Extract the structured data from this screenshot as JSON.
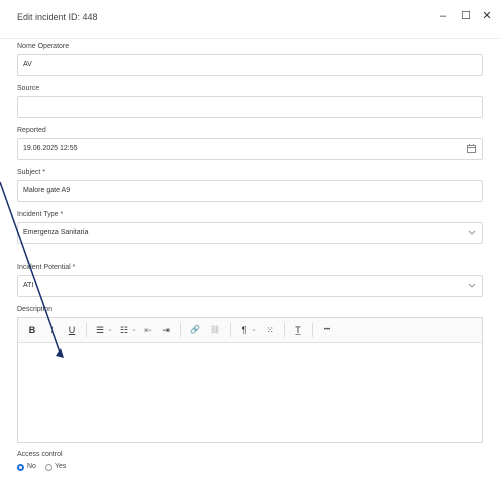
{
  "dialog": {
    "title": "Edit incident ID: 448",
    "minimize_glyph": "–",
    "maximize_glyph": "☐",
    "close_glyph": "✕"
  },
  "form": {
    "nome_operatore": {
      "label": "Nome Operatore",
      "value": "AV"
    },
    "source": {
      "label": "Source",
      "value": ""
    },
    "reported": {
      "label": "Reported",
      "value": "19.06.2025 12:55",
      "icon": "calendar-icon"
    },
    "subject": {
      "label": "Subject *",
      "value": "Malore gate A9"
    },
    "incident_type": {
      "label": "Incident Type *",
      "value": "Emergenza Sanitaria",
      "icon": "chevron-down-icon"
    },
    "incident_potential": {
      "label": "Incident Potential *",
      "value": "ATI",
      "icon": "chevron-down-icon"
    },
    "description": {
      "label": "Description",
      "value": "",
      "toolbar": {
        "bold": "B",
        "italic": "I",
        "underline": "U",
        "bullet_list": "☰",
        "numbered_list": "☷",
        "outdent": "⇤",
        "indent": "⇥",
        "link": "🔗",
        "unlink": "⛓",
        "format": "¶",
        "align": "⁙",
        "clear_format": "T̲",
        "more": "•••",
        "dropdown": "⌄"
      }
    },
    "access_control": {
      "label": "Access control",
      "options": [
        {
          "label": "No",
          "selected": true
        },
        {
          "label": "Yes",
          "selected": false
        }
      ]
    }
  },
  "colors": {
    "accent": "#1e6fd9",
    "border": "#d9d9d9",
    "arrow": "#1a2f6b"
  }
}
